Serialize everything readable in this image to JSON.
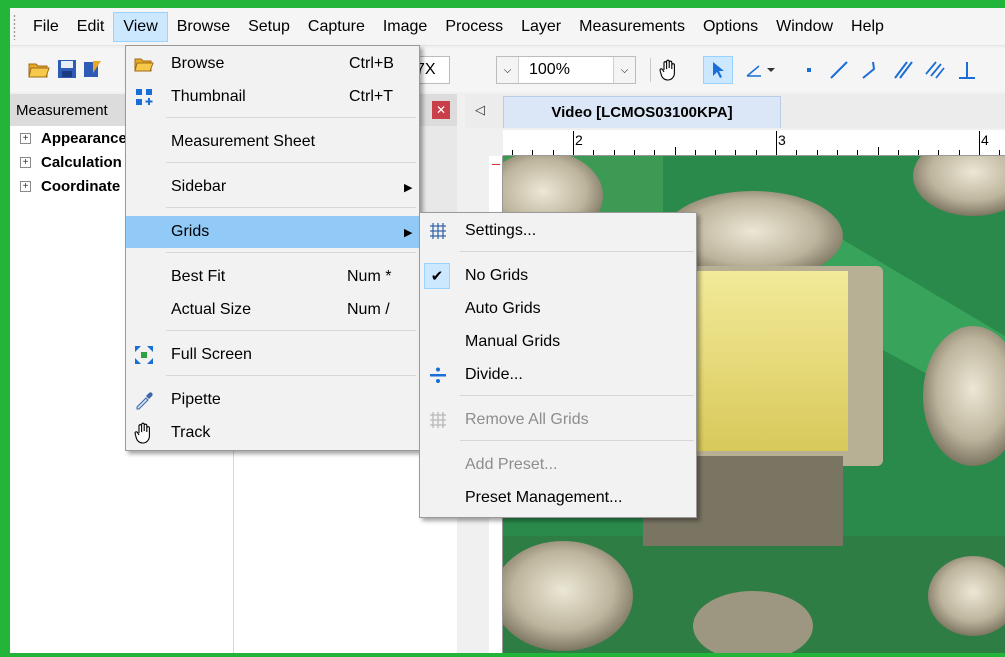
{
  "menubar": {
    "items": [
      "File",
      "Edit",
      "View",
      "Browse",
      "Setup",
      "Capture",
      "Image",
      "Process",
      "Layer",
      "Measurements",
      "Options",
      "Window",
      "Help"
    ]
  },
  "toolbar": {
    "zoom_partial": "7X",
    "zoom_value": "100%"
  },
  "left_panel": {
    "title": "Measurement",
    "tree": [
      "Appearance",
      "Calculation",
      "Coordinate"
    ]
  },
  "video": {
    "tab_label": "Video [LCMOS03100KPA]",
    "ruler_labels": [
      "2",
      "3",
      "4"
    ]
  },
  "view_menu": {
    "items": [
      {
        "label": "Browse",
        "shortcut": "Ctrl+B",
        "icon": "folder-open-icon"
      },
      {
        "label": "Thumbnail",
        "shortcut": "Ctrl+T",
        "icon": "thumbnail-grid-icon"
      },
      {
        "label": "Measurement Sheet",
        "shortcut": ""
      },
      {
        "label": "Sidebar",
        "submenu": true
      },
      {
        "label": "Grids",
        "submenu": true,
        "highlighted": true
      },
      {
        "label": "Best Fit",
        "shortcut": "Num *"
      },
      {
        "label": "Actual Size",
        "shortcut": "Num /"
      },
      {
        "label": "Full Screen",
        "icon": "fullscreen-icon"
      },
      {
        "label": "Pipette",
        "icon": "pipette-icon"
      },
      {
        "label": "Track",
        "icon": "hand-icon"
      }
    ]
  },
  "grids_submenu": {
    "items": [
      {
        "label": "Settings...",
        "icon": "grid-icon"
      },
      {
        "label": "No Grids",
        "checked": true
      },
      {
        "label": "Auto Grids"
      },
      {
        "label": "Manual Grids"
      },
      {
        "label": "Divide...",
        "icon": "divide-icon"
      },
      {
        "label": "Remove All Grids",
        "disabled": true,
        "icon": "remove-grid-icon"
      },
      {
        "label": "Add Preset...",
        "disabled": true
      },
      {
        "label": "Preset Management..."
      }
    ]
  },
  "colors": {
    "frame_green": "#22b53a",
    "highlight": "#91c9f7",
    "selected_bg": "#cce8ff"
  }
}
